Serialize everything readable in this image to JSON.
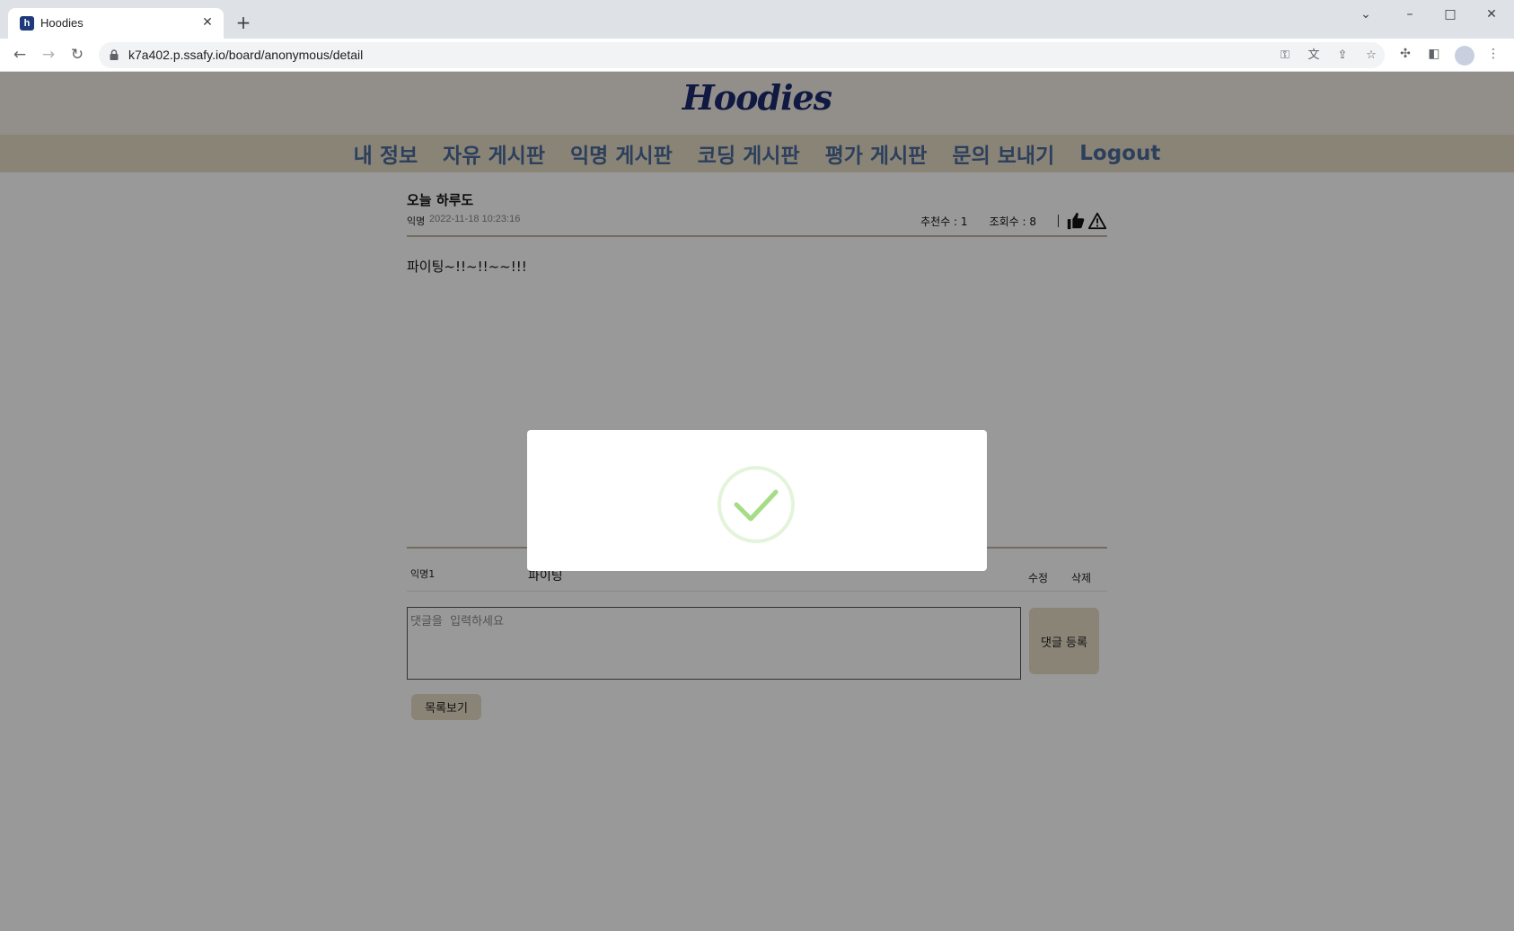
{
  "browser": {
    "tab_title": "Hoodies",
    "tab_favicon": "h",
    "url": "k7a402.p.ssafy.io/board/anonymous/detail"
  },
  "site": {
    "logo": "Hoodies",
    "nav": [
      "내 정보",
      "자유 게시판",
      "익명 게시판",
      "코딩 게시판",
      "평가 게시판",
      "문의 보내기",
      "Logout"
    ]
  },
  "post": {
    "title": "오늘 하루도",
    "author": "익명",
    "date": "2022-11-18 10:23:16",
    "likes": "추천수 : 1",
    "views": "조회수 : 8",
    "body": "파이팅~!!~!!~~!!!"
  },
  "comments": [
    {
      "author": "익명1",
      "text": "파이팅",
      "edit_label": "수정",
      "delete_label": "삭제"
    }
  ],
  "comment_form": {
    "placeholder": "댓글을  입력하세요",
    "submit_label": "댓글 등록"
  },
  "list_button": "목록보기",
  "modal": {
    "icon": "success-check-icon",
    "accent_color": "#a5dc86"
  }
}
